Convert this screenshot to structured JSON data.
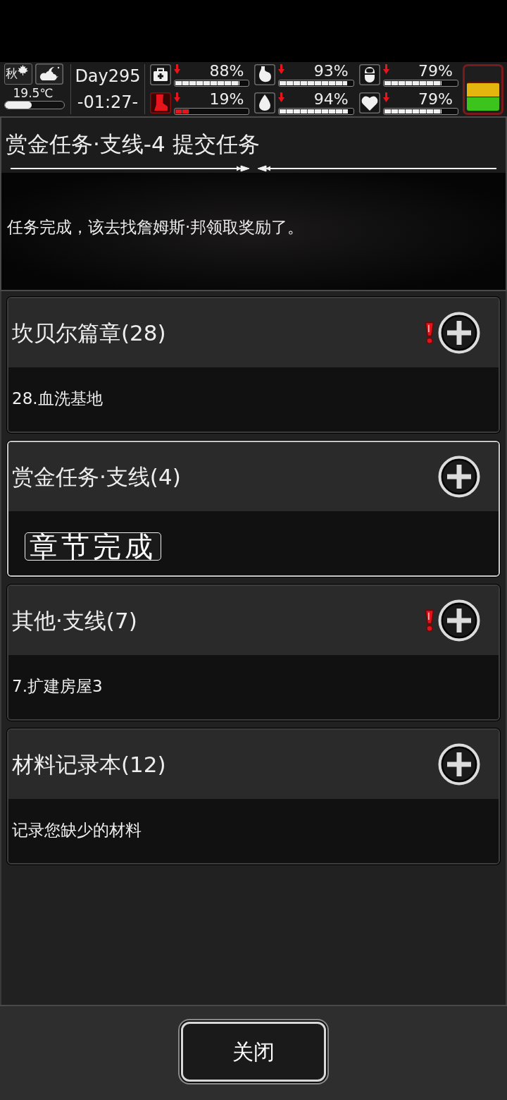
{
  "status_bar": {
    "season": "秋",
    "temperature": "19.5℃",
    "temperature_gauge": {
      "level": 0.45
    },
    "day": "Day295",
    "time": "-01:27-",
    "stats": [
      {
        "kind": "medkit",
        "value": "88%",
        "level": 0.88,
        "falling": true,
        "critical": false
      },
      {
        "kind": "stomach",
        "value": "93%",
        "level": 0.93,
        "falling": true,
        "critical": false
      },
      {
        "kind": "capsule",
        "value": "79%",
        "level": 0.79,
        "falling": true,
        "critical": false
      },
      {
        "kind": "boot",
        "value": "19%",
        "level": 0.19,
        "falling": true,
        "critical": true
      },
      {
        "kind": "drop",
        "value": "94%",
        "level": 0.94,
        "falling": true,
        "critical": false
      },
      {
        "kind": "heart",
        "value": "79%",
        "level": 0.79,
        "falling": true,
        "critical": false
      }
    ],
    "battery": {
      "level": 0.67
    }
  },
  "quest": {
    "title": "赏金任务·支线-4 提交任务",
    "description": "任务完成，该去找詹姆斯·邦领取奖励了。"
  },
  "categories": [
    {
      "title": "坎贝尔篇章(28)",
      "alert": true,
      "selected": false,
      "body": {
        "kind": "text",
        "text": "28.血洗基地"
      }
    },
    {
      "title": "赏金任务·支线(4)",
      "alert": false,
      "selected": true,
      "body": {
        "kind": "stamp",
        "text": "章节完成"
      }
    },
    {
      "title": "其他·支线(7)",
      "alert": true,
      "selected": false,
      "body": {
        "kind": "text",
        "text": "7.扩建房屋3"
      }
    },
    {
      "title": "材料记录本(12)",
      "alert": false,
      "selected": false,
      "body": {
        "kind": "text",
        "text": "记录您缺少的材料"
      }
    }
  ],
  "close_button": "关闭"
}
